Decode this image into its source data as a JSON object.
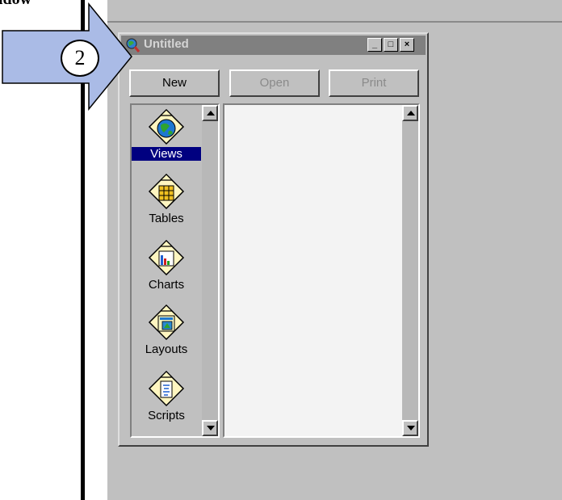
{
  "caption": "idow",
  "step_number": "2",
  "window": {
    "title": "Untitled",
    "controls": {
      "minimize": "_",
      "maximize": "□",
      "close": "×"
    }
  },
  "buttons": {
    "new": "New",
    "open": "Open",
    "print": "Print"
  },
  "doc_types": [
    {
      "label": "Views",
      "icon": "globe-icon",
      "selected": true
    },
    {
      "label": "Tables",
      "icon": "table-icon",
      "selected": false
    },
    {
      "label": "Charts",
      "icon": "chart-icon",
      "selected": false
    },
    {
      "label": "Layouts",
      "icon": "layout-icon",
      "selected": false
    },
    {
      "label": "Scripts",
      "icon": "script-icon",
      "selected": false
    }
  ],
  "colors": {
    "selection": "#000080",
    "arrow_fill": "#aabbe6",
    "inactive_titlebar": "#808080",
    "desktop": "#c0c0c0"
  }
}
